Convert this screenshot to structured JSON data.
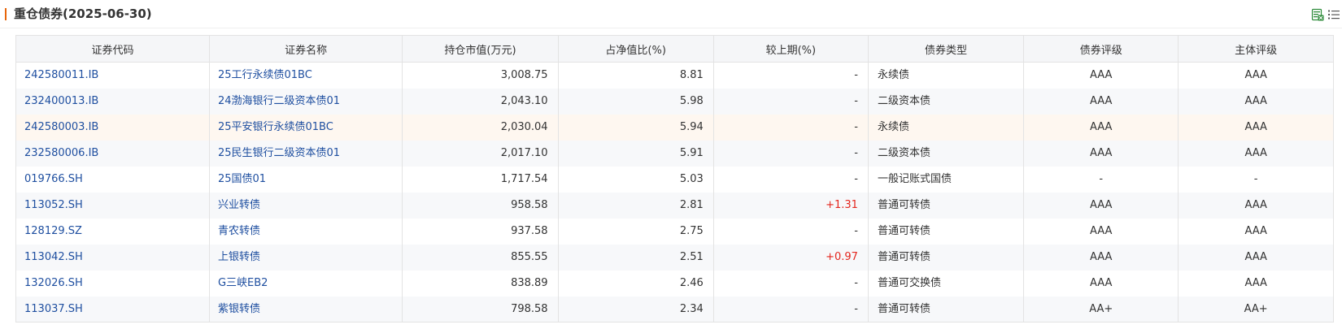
{
  "header": {
    "title": "重仓债券(2025-06-30)",
    "icons": [
      "export-excel-icon",
      "list-settings-icon"
    ]
  },
  "table": {
    "columns": [
      "证券代码",
      "证券名称",
      "持仓市值(万元)",
      "占净值比(%)",
      "较上期(%)",
      "债券类型",
      "债券评级",
      "主体评级"
    ],
    "rows": [
      {
        "code": "242580011.IB",
        "name": "25工行永续债01BC",
        "value": "3,008.75",
        "ratio": "8.81",
        "change": "-",
        "type": "永续债",
        "bond_rating": "AAA",
        "issuer_rating": "AAA"
      },
      {
        "code": "232400013.IB",
        "name": "24渤海银行二级资本债01",
        "value": "2,043.10",
        "ratio": "5.98",
        "change": "-",
        "type": "二级资本债",
        "bond_rating": "AAA",
        "issuer_rating": "AAA"
      },
      {
        "code": "242580003.IB",
        "name": "25平安银行永续债01BC",
        "value": "2,030.04",
        "ratio": "5.94",
        "change": "-",
        "type": "永续债",
        "bond_rating": "AAA",
        "issuer_rating": "AAA"
      },
      {
        "code": "232580006.IB",
        "name": "25民生银行二级资本债01",
        "value": "2,017.10",
        "ratio": "5.91",
        "change": "-",
        "type": "二级资本债",
        "bond_rating": "AAA",
        "issuer_rating": "AAA"
      },
      {
        "code": "019766.SH",
        "name": "25国债01",
        "value": "1,717.54",
        "ratio": "5.03",
        "change": "-",
        "type": "一般记账式国债",
        "bond_rating": "-",
        "issuer_rating": "-"
      },
      {
        "code": "113052.SH",
        "name": "兴业转债",
        "value": "958.58",
        "ratio": "2.81",
        "change": "+1.31",
        "type": "普通可转债",
        "bond_rating": "AAA",
        "issuer_rating": "AAA"
      },
      {
        "code": "128129.SZ",
        "name": "青农转债",
        "value": "937.58",
        "ratio": "2.75",
        "change": "-",
        "type": "普通可转债",
        "bond_rating": "AAA",
        "issuer_rating": "AAA"
      },
      {
        "code": "113042.SH",
        "name": "上银转债",
        "value": "855.55",
        "ratio": "2.51",
        "change": "+0.97",
        "type": "普通可转债",
        "bond_rating": "AAA",
        "issuer_rating": "AAA"
      },
      {
        "code": "132026.SH",
        "name": "G三峡EB2",
        "value": "838.89",
        "ratio": "2.46",
        "change": "-",
        "type": "普通可交换债",
        "bond_rating": "AAA",
        "issuer_rating": "AAA"
      },
      {
        "code": "113037.SH",
        "name": "紫银转债",
        "value": "798.58",
        "ratio": "2.34",
        "change": "-",
        "type": "普通可转债",
        "bond_rating": "AA+",
        "issuer_rating": "AA+"
      }
    ],
    "highlighted_row": 2
  },
  "colors": {
    "accent": "#e8650a",
    "link": "#1f4fa0",
    "positive_change": "#e4261e",
    "header_bg": "#f5f6f8",
    "stripe_bg": "#f7f8fa",
    "hover_bg": "#fef7f0"
  }
}
